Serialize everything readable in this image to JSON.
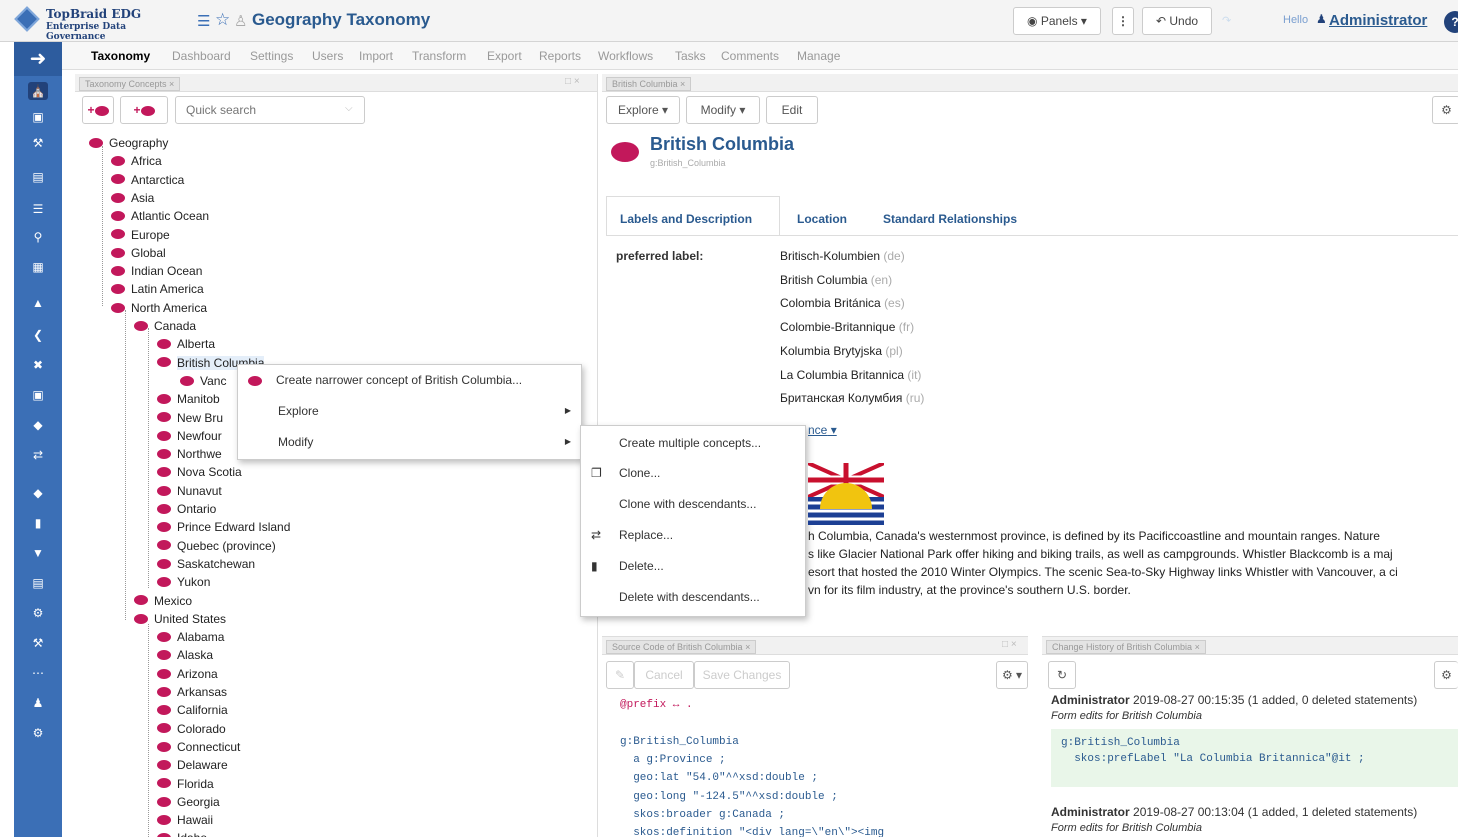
{
  "header": {
    "logo_line1": "TopBraid EDG",
    "logo_line2": "Enterprise Data Governance",
    "title": "Geography Taxonomy",
    "panels_label": "Panels",
    "undo_label": "Undo",
    "hello": "Hello",
    "user": "Administrator"
  },
  "menu": [
    "Taxonomy",
    "Dashboard",
    "Settings",
    "Users",
    "Import",
    "Transform",
    "Export",
    "Reports",
    "Workflows",
    "Tasks",
    "Comments",
    "Manage"
  ],
  "left_panel": {
    "tab": "Taxonomy Concepts",
    "search_placeholder": "Quick search"
  },
  "tree": [
    {
      "label": "Geography",
      "level": 0
    },
    {
      "label": "Africa",
      "level": 1
    },
    {
      "label": "Antarctica",
      "level": 1
    },
    {
      "label": "Asia",
      "level": 1
    },
    {
      "label": "Atlantic Ocean",
      "level": 1
    },
    {
      "label": "Europe",
      "level": 1
    },
    {
      "label": "Global",
      "level": 1
    },
    {
      "label": "Indian Ocean",
      "level": 1
    },
    {
      "label": "Latin America",
      "level": 1
    },
    {
      "label": "North America",
      "level": 1
    },
    {
      "label": "Canada",
      "level": 2
    },
    {
      "label": "Alberta",
      "level": 3
    },
    {
      "label": "British Columbia",
      "level": 3
    },
    {
      "label": "Vanc",
      "level": 4
    },
    {
      "label": "Manitob",
      "level": 3
    },
    {
      "label": "New Bru",
      "level": 3
    },
    {
      "label": "Newfour",
      "level": 3
    },
    {
      "label": "Northwe",
      "level": 3
    },
    {
      "label": "Nova Scotia",
      "level": 3
    },
    {
      "label": "Nunavut",
      "level": 3
    },
    {
      "label": "Ontario",
      "level": 3
    },
    {
      "label": "Prince Edward Island",
      "level": 3
    },
    {
      "label": "Quebec (province)",
      "level": 3
    },
    {
      "label": "Saskatchewan",
      "level": 3
    },
    {
      "label": "Yukon",
      "level": 3
    },
    {
      "label": "Mexico",
      "level": 2
    },
    {
      "label": "United States",
      "level": 2
    },
    {
      "label": "Alabama",
      "level": 3
    },
    {
      "label": "Alaska",
      "level": 3
    },
    {
      "label": "Arizona",
      "level": 3
    },
    {
      "label": "Arkansas",
      "level": 3
    },
    {
      "label": "California",
      "level": 3
    },
    {
      "label": "Colorado",
      "level": 3
    },
    {
      "label": "Connecticut",
      "level": 3
    },
    {
      "label": "Delaware",
      "level": 3
    },
    {
      "label": "Florida",
      "level": 3
    },
    {
      "label": "Georgia",
      "level": 3
    },
    {
      "label": "Hawaii",
      "level": 3
    },
    {
      "label": "Idaho",
      "level": 3
    }
  ],
  "context_menu": {
    "create_narrower": "Create narrower concept of British Columbia...",
    "explore": "Explore",
    "modify": "Modify"
  },
  "submenu": [
    "Create multiple concepts...",
    "Clone...",
    "Clone with descendants...",
    "Replace...",
    "Delete...",
    "Delete with descendants..."
  ],
  "right_panel": {
    "tab": "British Columbia",
    "explore": "Explore",
    "modify": "Modify",
    "edit": "Edit",
    "concept_title": "British Columbia",
    "concept_id": "g:British_Columbia",
    "tabs": [
      "Labels and Description",
      "Location",
      "Standard Relationships"
    ],
    "pref_label_title": "preferred label:",
    "labels": [
      {
        "text": "Britisch-Kolumbien",
        "lang": "(de)"
      },
      {
        "text": "British Columbia",
        "lang": "(en)"
      },
      {
        "text": "Colombia Británica",
        "lang": "(es)"
      },
      {
        "text": "Colombie-Britannique",
        "lang": "(fr)"
      },
      {
        "text": "Kolumbia Brytyjska",
        "lang": "(pl)"
      },
      {
        "text": "La Columbia Britannica",
        "lang": "(it)"
      },
      {
        "text": "Британская Колумбия",
        "lang": "(ru)"
      }
    ],
    "more_link": "nce",
    "desc_lines": [
      "h Columbia, Canada's westernmost province, is defined by its Pacificcoastline and mountain ranges. Nature",
      "s like Glacier National Park offer hiking and biking trails, as well as campgrounds. Whistler Blackcomb is a maj",
      "esort that hosted the 2010 Winter Olympics. The scenic Sea-to-Sky Highway links Whistler with Vancouver, a ci",
      "vn for its film industry, at the province's southern U.S. border."
    ]
  },
  "source_panel": {
    "tab": "Source Code of British Columbia",
    "cancel": "Cancel",
    "save": "Save Changes",
    "lines": [
      "@prefix ↔ .",
      "",
      "g:British_Columbia",
      "  a g:Province ;",
      "  geo:lat \"54.0\"^^xsd:double ;",
      "  geo:long \"-124.5\"^^xsd:double ;",
      "  skos:broader g:Canada ;",
      "  skos:definition \"<div lang=\\\"en\\\"><img"
    ]
  },
  "history_panel": {
    "tab": "Change History of British Columbia",
    "entries": [
      {
        "user": "Administrator",
        "info": " 2019-08-27 00:15:35 (1 added, 0 deleted statements)",
        "note": "Form edits for British Columbia"
      },
      {
        "user": "Administrator",
        "info": " 2019-08-27 00:13:04 (1 added, 1 deleted statements)",
        "note": "Form edits for British Columbia"
      }
    ],
    "code1": "g:British_Columbia",
    "code2": "  skos:prefLabel \"La Columbia Britannica\"@it ;"
  }
}
